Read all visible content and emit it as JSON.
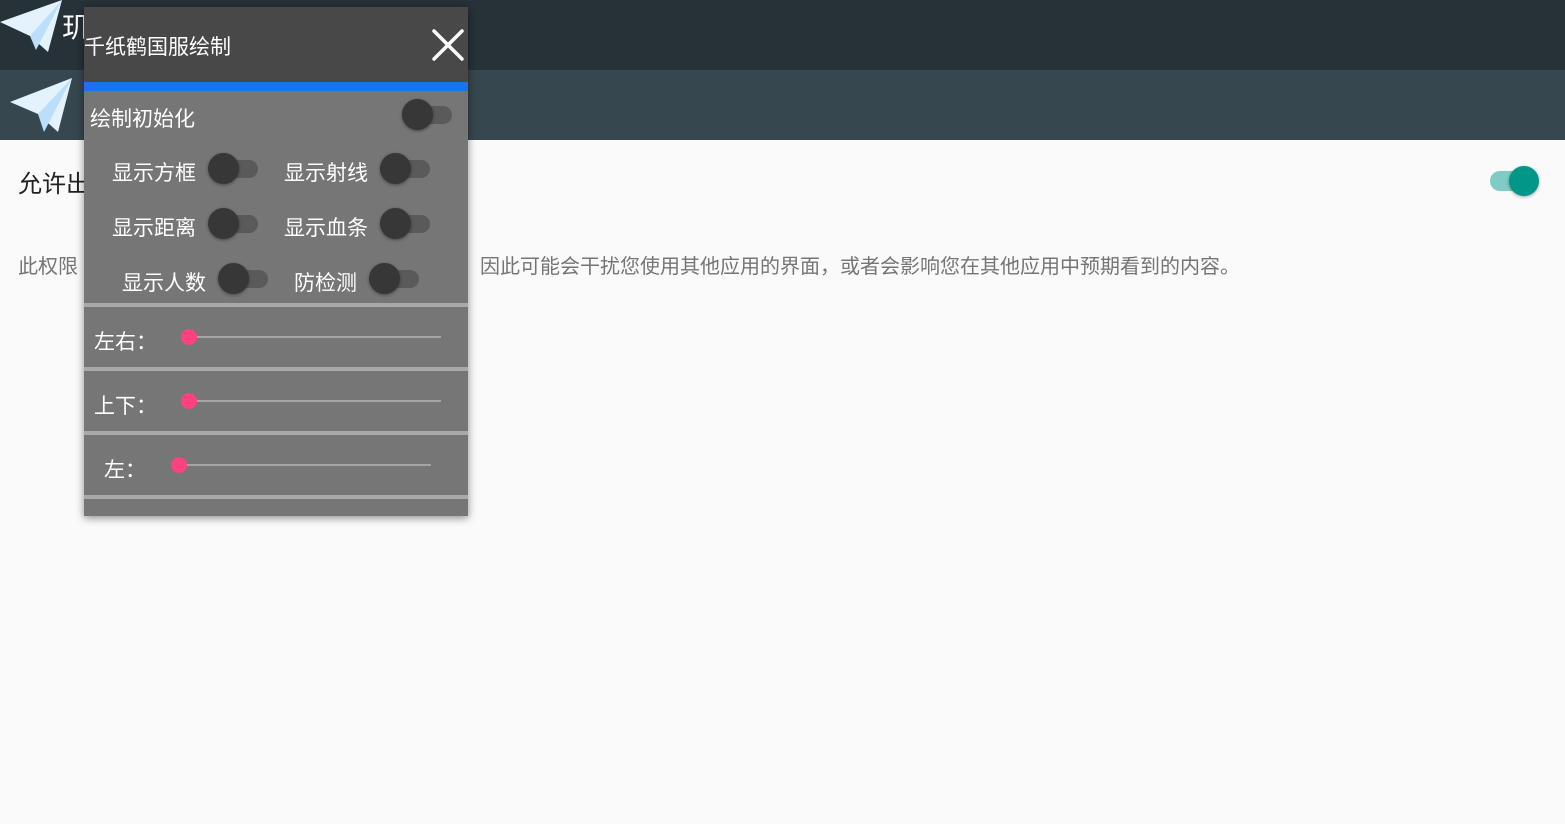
{
  "statusbar": {
    "app_name_partial": "玑"
  },
  "setting": {
    "title_partial": "允许出",
    "description_left": "此权限",
    "description_right": "因此可能会干扰您使用其他应用的界面，或者会影响您在其他应用中预期看到的内容。",
    "toggle_on": true,
    "accent_color": "#009688"
  },
  "overlay": {
    "title": "千纸鹤国服绘制",
    "close_icon": "close-icon",
    "accent_color": "#1a73e8",
    "init_label": "绘制初始化",
    "toggles": {
      "show_box": "显示方框",
      "show_ray": "显示射线",
      "show_distance": "显示距离",
      "show_health": "显示血条",
      "show_count": "显示人数",
      "anti_detect": "防检测"
    },
    "sliders": {
      "horizontal_label": "左右：",
      "vertical_label": "上下：",
      "left_label": "左：",
      "thumb_color": "#ff4081"
    }
  }
}
